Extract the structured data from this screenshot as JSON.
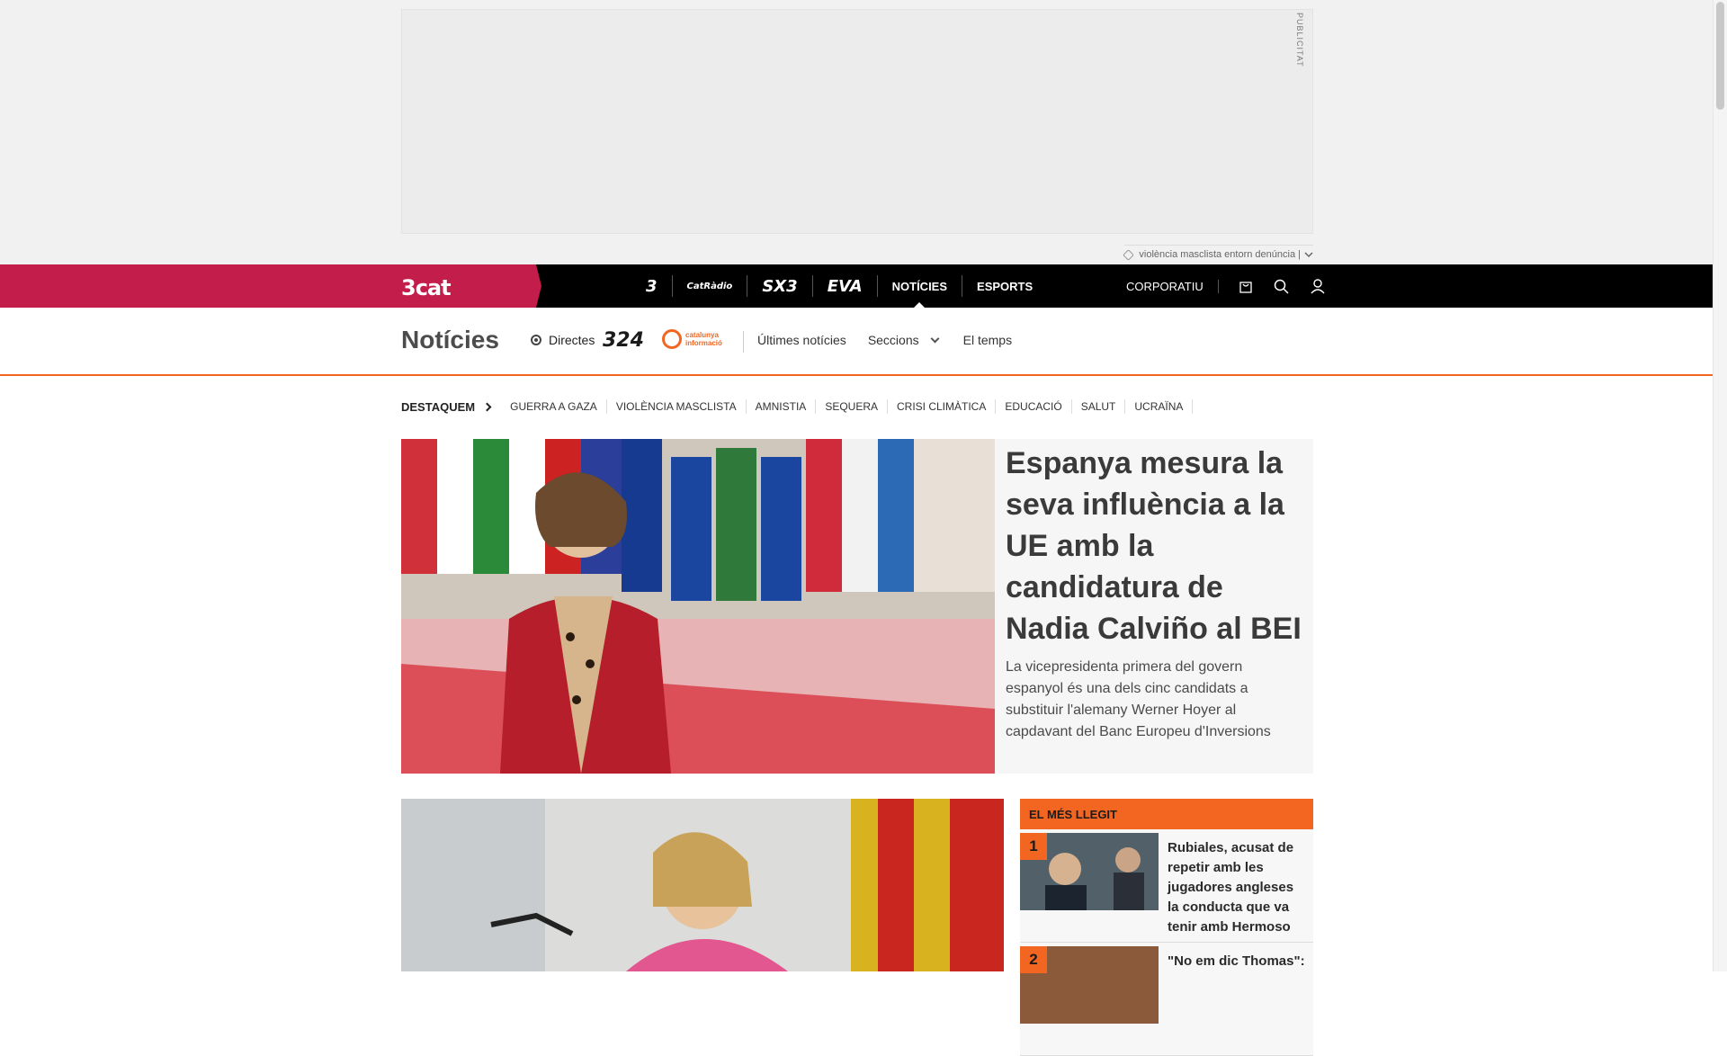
{
  "ad": {
    "label": "PUBLICITAT",
    "tagline": "violència masclista entorn denúncia |"
  },
  "topbar": {
    "brand": "3cat",
    "channels": [
      {
        "label": "3",
        "style": "logo"
      },
      {
        "label": "CatRàdio",
        "style": "logo"
      },
      {
        "label": "SX3",
        "style": "logo"
      },
      {
        "label": "EVA",
        "style": "logo"
      },
      {
        "label": "NOTÍCIES",
        "style": "text"
      },
      {
        "label": "ESPORTS",
        "style": "text"
      }
    ],
    "corporate": "CORPORATIU",
    "icons": [
      "shopping-bag-icon",
      "search-icon",
      "user-icon"
    ],
    "brand_color": "#c31d4c"
  },
  "section": {
    "title": "Notícies",
    "directes": "Directes",
    "logo_324": "324",
    "logo_ci_line1": "catalunya",
    "logo_ci_line2": "informació",
    "nav": [
      "Últimes notícies",
      "Seccions",
      "El temps"
    ],
    "accent_color": "#f26622"
  },
  "destaquem": {
    "label": "DESTAQUEM",
    "tags": [
      "GUERRA A GAZA",
      "VIOLÈNCIA MASCLISTA",
      "AMNISTIA",
      "SEQUERA",
      "CRISI CLIMÀTICA",
      "EDUCACIÓ",
      "SALUT",
      "UCRAÏNA"
    ]
  },
  "feature": {
    "title": "Espanya mesura la seva influència a la UE amb la candidatura de Nadia Calviño al BEI",
    "summary": "La vicepresidenta primera del govern espanyol és una dels cinc candidats a substituir l'alemany Werner Hoyer al capdavant del Banc Europeu d'Inversions"
  },
  "most_read": {
    "title": "EL MÉS LLEGIT",
    "items": [
      {
        "rank": "1",
        "title": "Rubiales, acusat de repetir amb les jugadores angleses la conducta que va tenir amb Hermoso"
      },
      {
        "rank": "2",
        "title": "\"No em dic Thomas\":"
      }
    ]
  }
}
